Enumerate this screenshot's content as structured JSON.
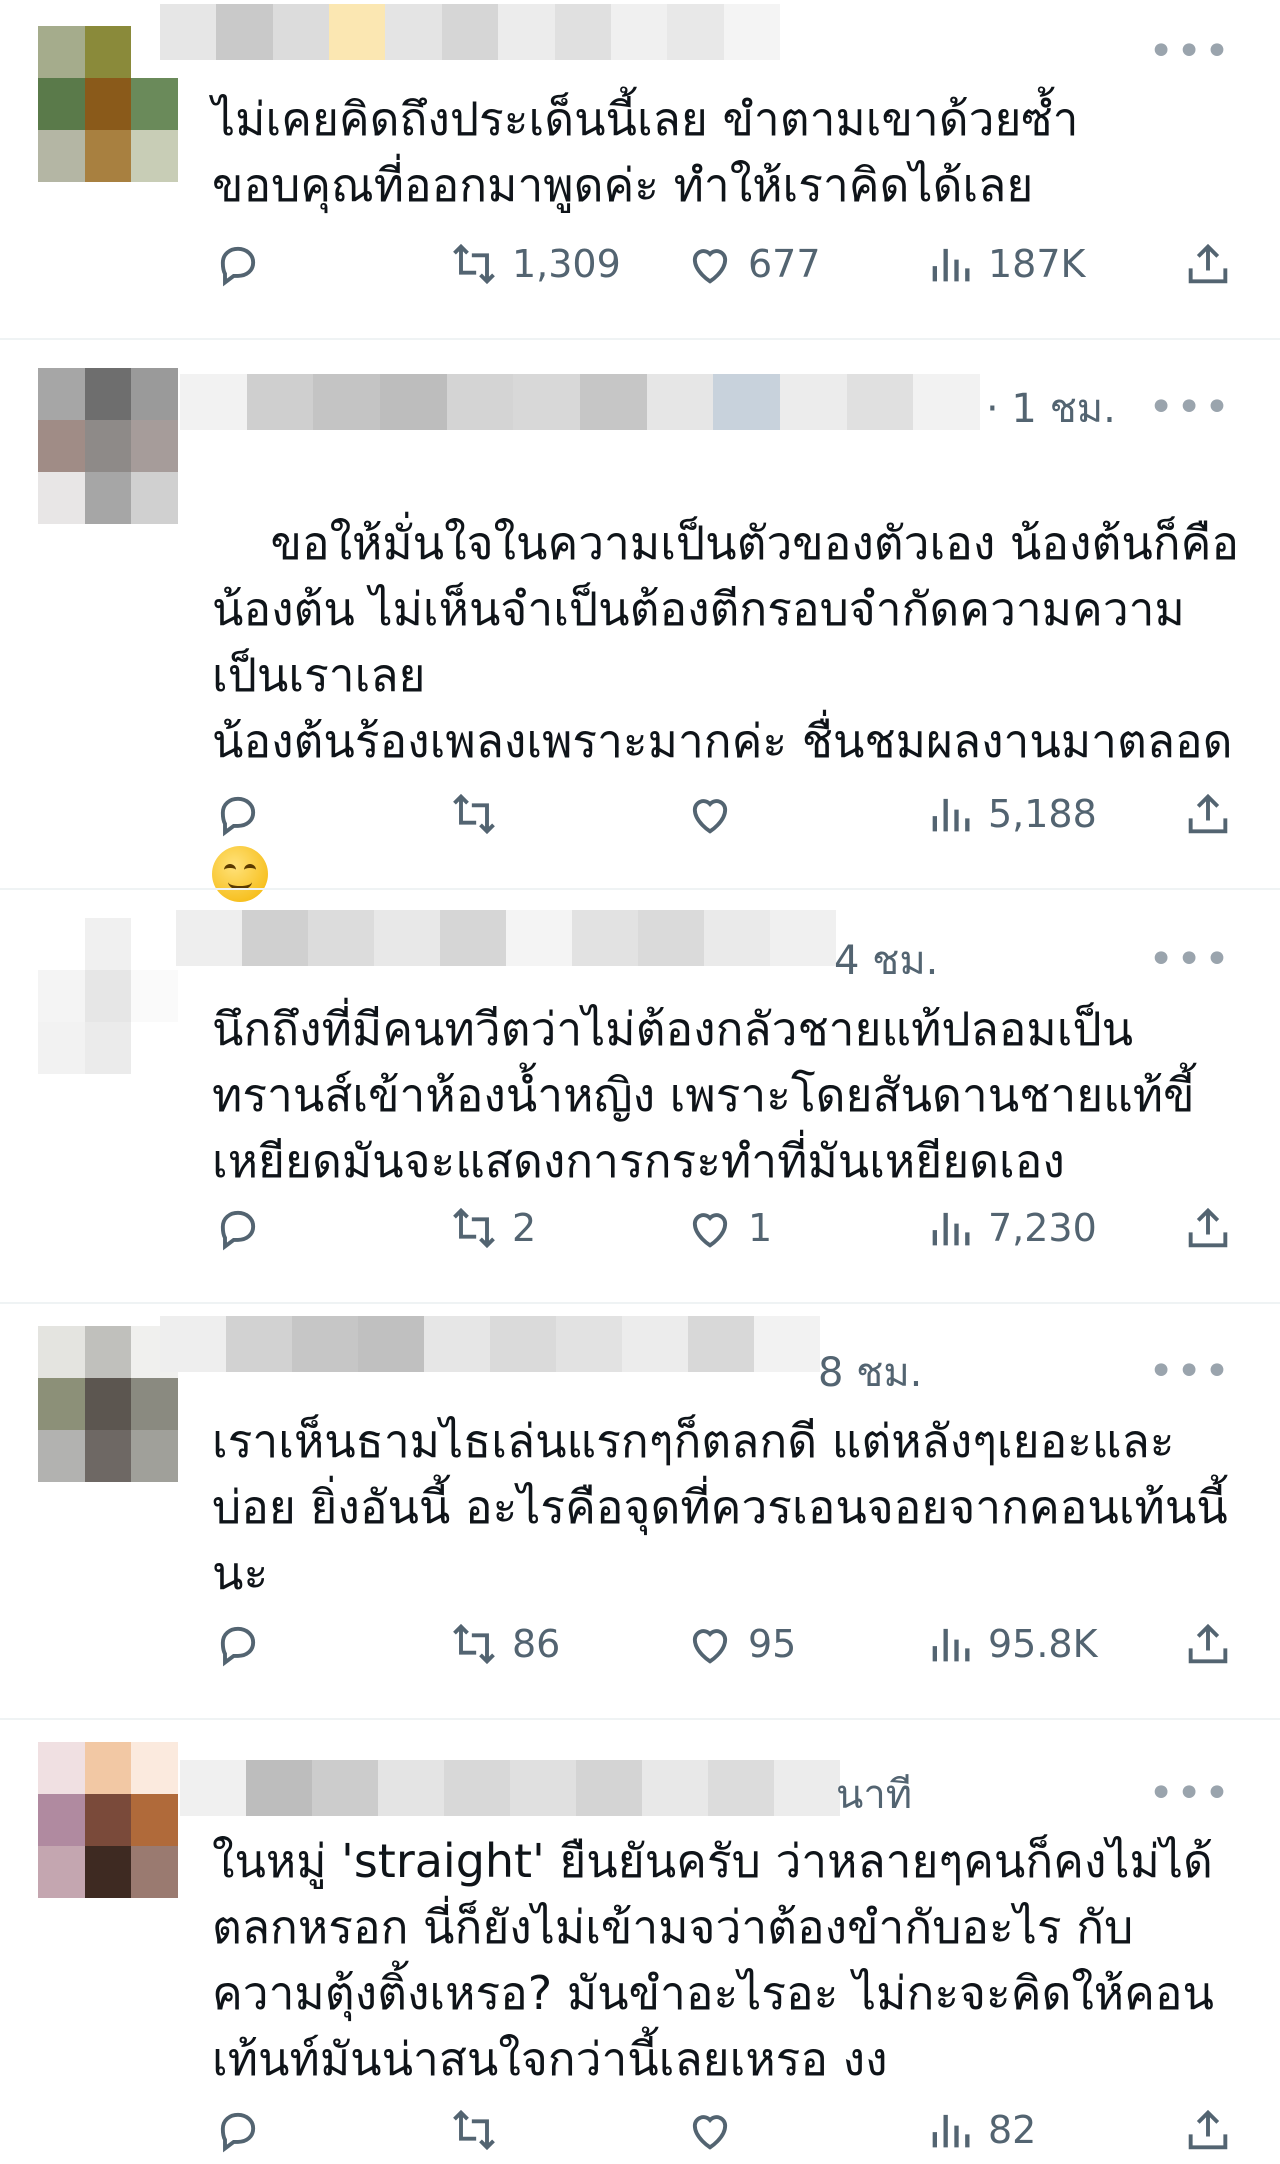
{
  "posts": [
    {
      "time": "",
      "text": "ไม่เคยคิดถึงประเด็นนี้เลย ขำตามเขาด้วยซ้ำ\nขอบคุณที่ออกมาพูดค่ะ ทำให้เราคิดได้เลย",
      "has_emoji": false,
      "replies": "",
      "reposts": "1,309",
      "likes": "677",
      "views": "187K"
    },
    {
      "time": "· 1 ชม.",
      "text": "ขอให้มั่นใจในความเป็นตัวของตัวเอง น้องต้นก็คือ\nน้องต้น ไม่เห็นจำเป็นต้องตีกรอบจำกัดความความ\nเป็นเราเลย\nน้องต้นร้องเพลงเพราะมากค่ะ ชื่นชมผลงานมาตลอด",
      "has_emoji": true,
      "replies": "",
      "reposts": "",
      "likes": "",
      "views": "5,188"
    },
    {
      "time": "4 ชม.",
      "text": "นึกถึงที่มีคนทวีตว่าไม่ต้องกลัวชายแท้ปลอมเป็น\nทรานส์เข้าห้องน้ำหญิง เพราะโดยสันดานชายแท้ขี้\nเหยียดมันจะแสดงการกระทำที่มันเหยียดเอง",
      "has_emoji": false,
      "replies": "",
      "reposts": "2",
      "likes": "1",
      "views": "7,230"
    },
    {
      "time": "8 ชม.",
      "text": "เราเห็นธามไธเล่นแรกๆก็ตลกดี แต่หลังๆเยอะและ\nบ่อย ยิ่งอันนี้ อะไรคือจุดที่ควรเอนจอยจากคอนเท้นนี้\nนะ",
      "has_emoji": false,
      "replies": "",
      "reposts": "86",
      "likes": "95",
      "views": "95.8K"
    },
    {
      "time": "นาที",
      "text": "ในหมู่ 'straight' ยืนยันครับ ว่าหลายๆคนก็คงไม่ได้\nตลกหรอก นี่ก็ยังไม่เข้ามจว่าต้องขำกับอะไร กับ\nความตุ้งติ้งเหรอ? มันขำอะไรอะ ไม่กะจะคิดให้คอน\nเท้นท์มันน่าสนใจกว่านี้เลยเหรอ งง",
      "has_emoji": false,
      "replies": "",
      "reposts": "",
      "likes": "",
      "views": "82"
    }
  ],
  "icons": {
    "more": "more-icon",
    "reply": "reply-icon",
    "repost": "repost-icon",
    "like": "like-icon",
    "views": "views-icon",
    "share": "share-icon"
  },
  "colors": {
    "text": "#0f1419",
    "secondary": "#536471",
    "divider": "#eff3f4"
  }
}
